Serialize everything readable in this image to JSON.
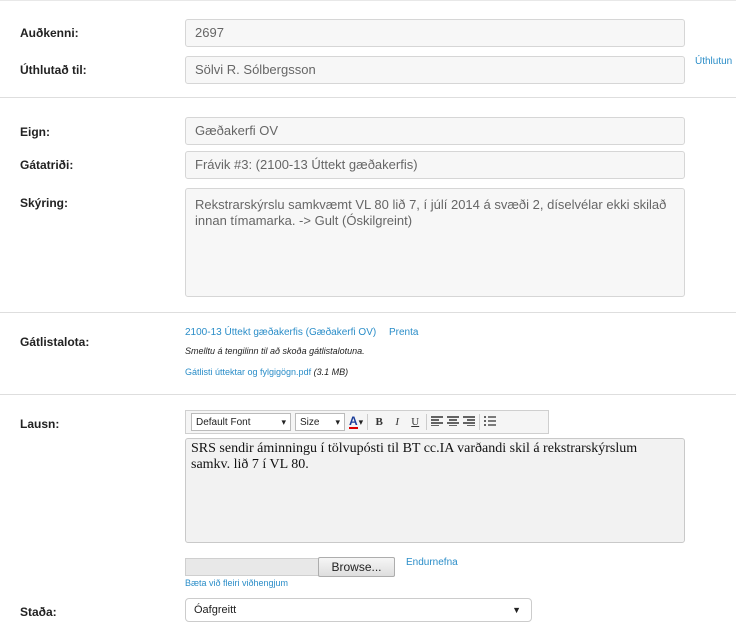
{
  "form": {
    "id_label": "Auðkenni:",
    "id_value": "2697",
    "assigned_label": "Úthlutað til:",
    "assigned_value": "Sölvi R. Sólbergsson",
    "assign_link": "Úthlutun",
    "asset_label": "Eign:",
    "asset_value": "Gæðakerfi OV",
    "checkitem_label": "Gátatriði:",
    "checkitem_value": "Frávik #3: (2100-13 Úttekt gæðakerfis)",
    "description_label": "Skýring:",
    "description_value": "Rekstrarskýrslu samkvæmt VL 80 lið 7, í júlí 2014 á svæði 2, díselvélar ekki skilað innan tímamarka. -> Gult (Óskilgreint)",
    "checklist_label": "Gátlistalota:",
    "checklist_link": "2100-13 Úttekt gæðakerfis (Gæðakerfi OV)",
    "print_link": "Prenta",
    "checklist_hint": "Smelltu á tengilinn til að skoða gátlistalotuna.",
    "attachment_link": "Gátlisti úttektar og fylgigögn.pdf",
    "attachment_size": "(3.1 MB)",
    "solution_label": "Lausn:",
    "solution_text": "SRS sendir áminningu í tölvupósti til BT cc.IA varðandi skil á rekstrarskýrslum samkv. lið 7 í VL 80.",
    "browse_label": "Browse...",
    "rename_link": "Endurnefna",
    "add_attachments_link": "Bæta við fleiri viðhengjum",
    "status_label": "Staða:",
    "status_value": "Óafgreitt"
  },
  "toolbar": {
    "font": "Default Font",
    "size": "Size",
    "font_color_glyph": "A",
    "bold": "B",
    "italic": "I",
    "underline": "U"
  }
}
